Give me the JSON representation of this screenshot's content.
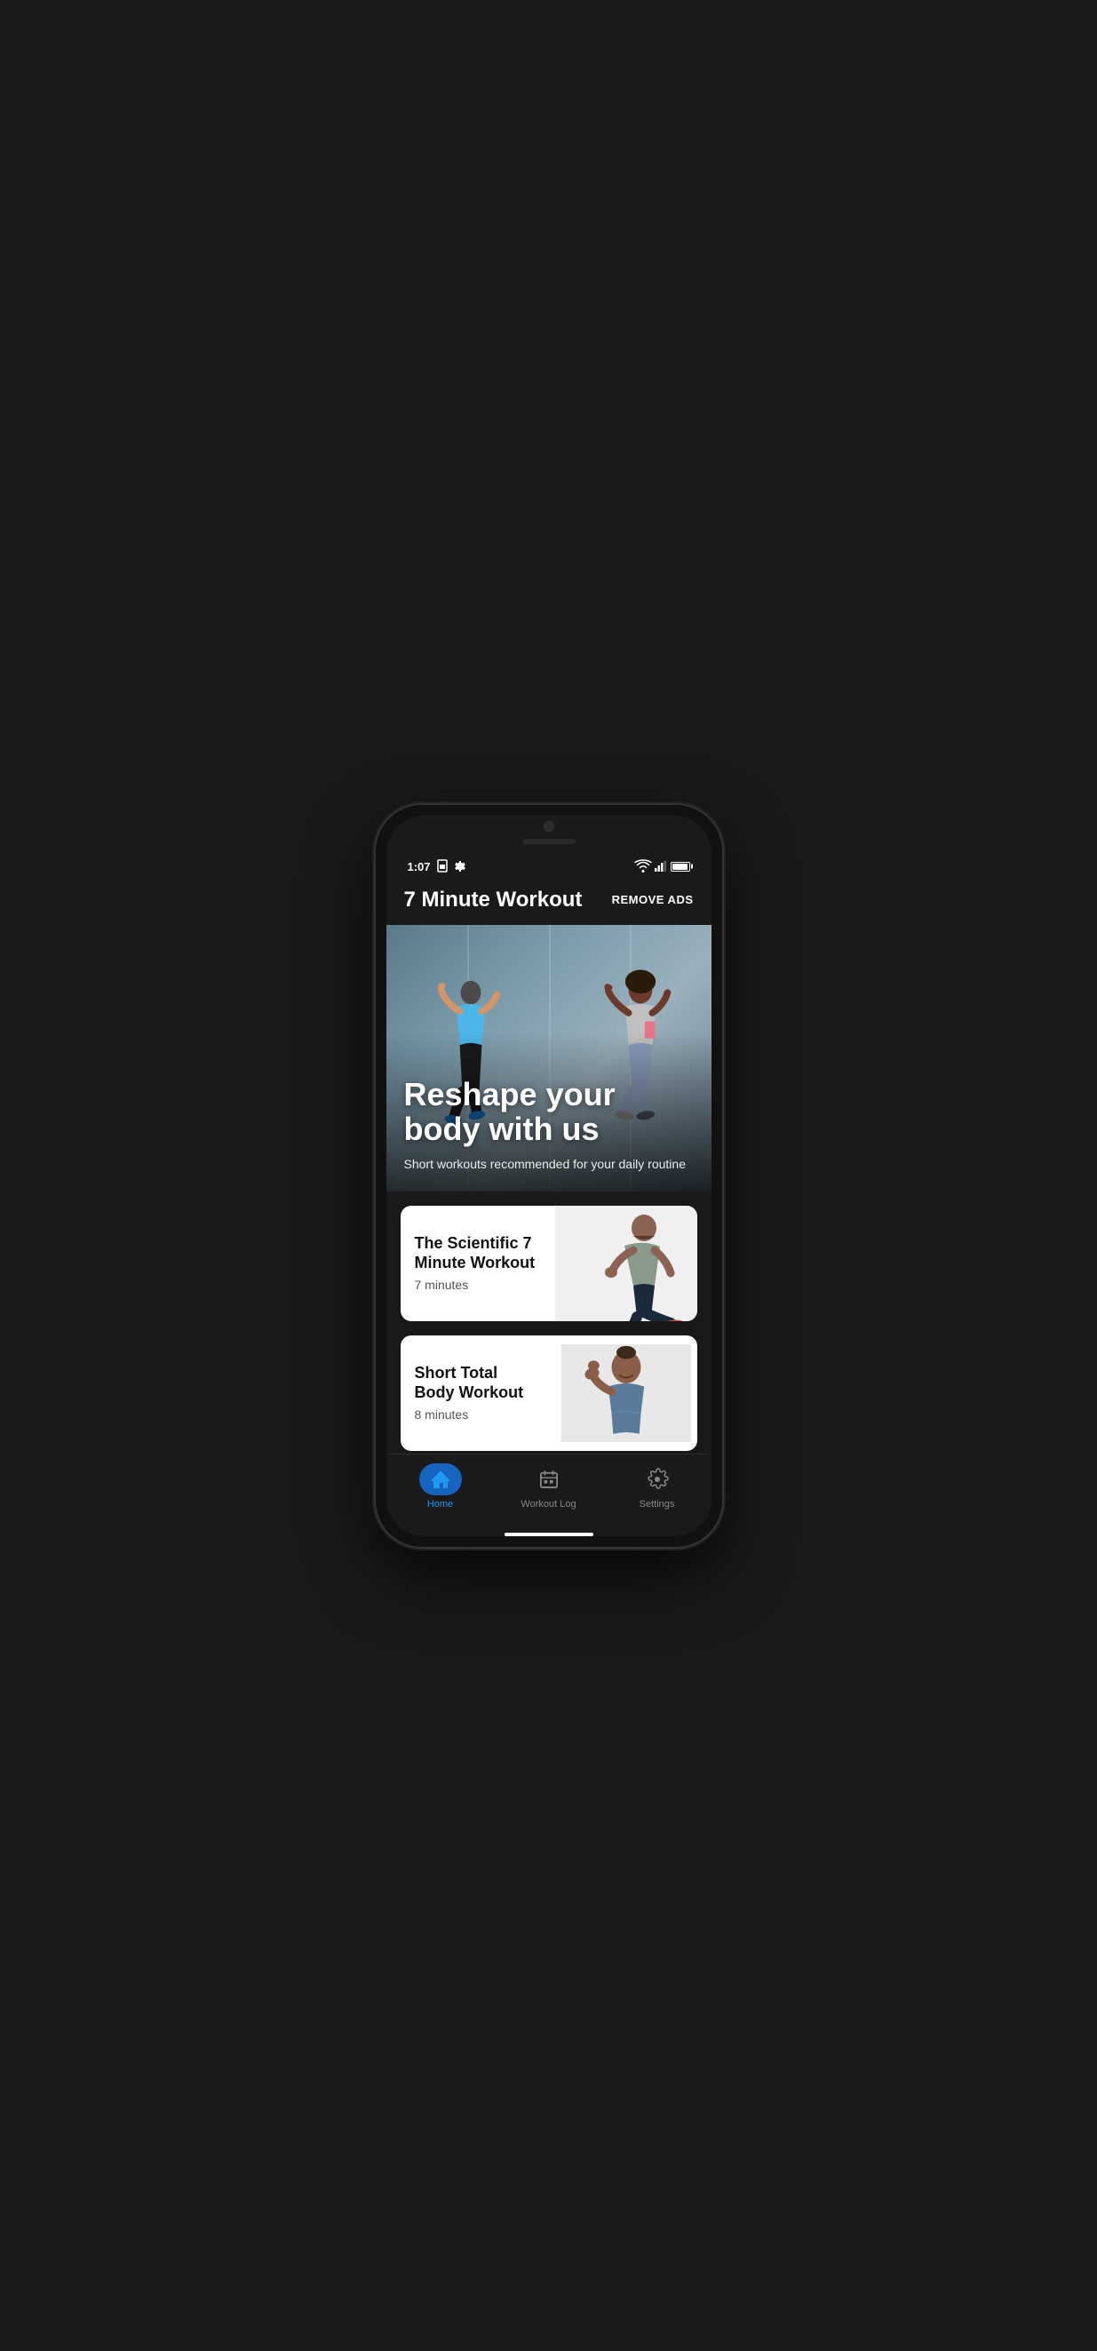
{
  "phone": {
    "status": {
      "time": "1:07",
      "icons": [
        "sim-card-icon",
        "settings-icon"
      ],
      "right_icons": [
        "wifi-icon",
        "signal-icon",
        "battery-icon"
      ]
    }
  },
  "header": {
    "app_title": "7 Minute Workout",
    "remove_ads_label": "REMOVE ADS"
  },
  "hero": {
    "title": "Reshape\nyour body\nwith us",
    "subtitle": "Short workouts recommended for your daily routine"
  },
  "workout_cards": [
    {
      "id": 1,
      "title": "The Scientific 7 Minute Workout",
      "duration": "7 minutes"
    },
    {
      "id": 2,
      "title": "Short Total Body Workout",
      "duration": "8 minutes"
    }
  ],
  "bottom_nav": {
    "items": [
      {
        "id": "home",
        "label": "Home",
        "active": true
      },
      {
        "id": "workout-log",
        "label": "Workout Log",
        "active": false
      },
      {
        "id": "settings",
        "label": "Settings",
        "active": false
      }
    ]
  }
}
